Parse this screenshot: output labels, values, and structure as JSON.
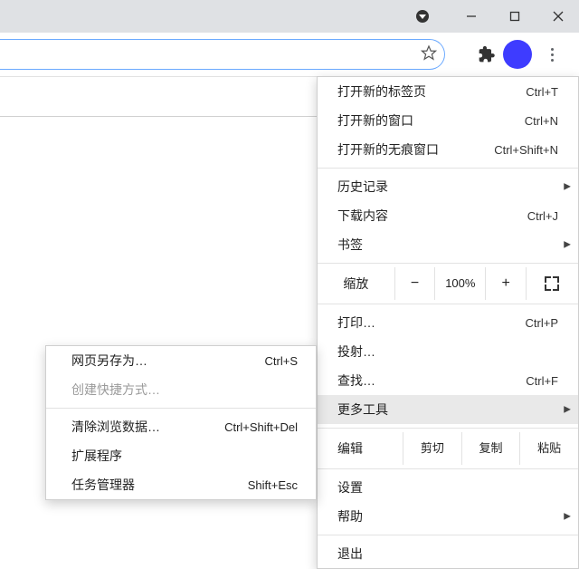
{
  "window_controls": {
    "audio": "audio",
    "minimize": "minimize",
    "maximize": "maximize",
    "close": "close"
  },
  "menu": {
    "new_tab": {
      "label": "打开新的标签页",
      "accel": "Ctrl+T"
    },
    "new_window": {
      "label": "打开新的窗口",
      "accel": "Ctrl+N"
    },
    "new_incognito": {
      "label": "打开新的无痕窗口",
      "accel": "Ctrl+Shift+N"
    },
    "history": {
      "label": "历史记录"
    },
    "downloads": {
      "label": "下载内容",
      "accel": "Ctrl+J"
    },
    "bookmarks": {
      "label": "书签"
    },
    "zoom": {
      "label": "缩放",
      "value": "100%",
      "minus": "−",
      "plus": "+"
    },
    "print": {
      "label": "打印…",
      "accel": "Ctrl+P"
    },
    "cast": {
      "label": "投射…"
    },
    "find": {
      "label": "查找…",
      "accel": "Ctrl+F"
    },
    "more_tools": {
      "label": "更多工具"
    },
    "edit": {
      "label": "编辑",
      "cut": "剪切",
      "copy": "复制",
      "paste": "粘贴"
    },
    "settings": {
      "label": "设置"
    },
    "help": {
      "label": "帮助"
    },
    "exit": {
      "label": "退出"
    }
  },
  "submenu": {
    "save_as": {
      "label": "网页另存为…",
      "accel": "Ctrl+S"
    },
    "create_shortcut": {
      "label": "创建快捷方式…"
    },
    "clear_data": {
      "label": "清除浏览数据…",
      "accel": "Ctrl+Shift+Del"
    },
    "extensions": {
      "label": "扩展程序"
    },
    "task_manager": {
      "label": "任务管理器",
      "accel": "Shift+Esc"
    }
  }
}
